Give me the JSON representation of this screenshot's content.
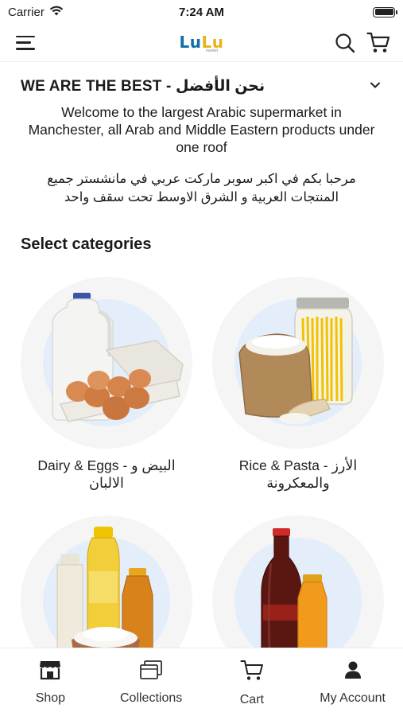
{
  "status_bar": {
    "carrier": "Carrier",
    "time": "7:24 AM"
  },
  "header": {
    "logo_left": "Lu",
    "logo_right": "Lu",
    "logo_sub": "market"
  },
  "welcome": {
    "title": "WE ARE THE BEST - نحن الأفضل",
    "text_en": "Welcome to the largest Arabic supermarket in Manchester, all Arab and Middle Eastern products under one roof",
    "text_ar": "مرحبا بكم في اكبر سوبر ماركت عربي في مانشستر جميع المنتجات العربية و الشرق الاوسط تحت سقف واحد"
  },
  "categories": {
    "title": "Select categories",
    "items": [
      {
        "label": "Dairy & Eggs - البيض و الالبان",
        "icon": "dairy-eggs-image"
      },
      {
        "label": "Rice & Pasta - الأرز والمعكرونة",
        "icon": "rice-pasta-image"
      },
      {
        "label": "",
        "icon": "oils-flour-image"
      },
      {
        "label": "",
        "icon": "drinks-image"
      }
    ]
  },
  "tabbar": {
    "items": [
      {
        "label": "Shop",
        "icon": "shop-icon"
      },
      {
        "label": "Collections",
        "icon": "collections-icon"
      },
      {
        "label": "Cart",
        "icon": "cart-icon"
      },
      {
        "label": "My Account",
        "icon": "account-icon"
      }
    ]
  },
  "colors": {
    "logo_blue": "#0e6ea8",
    "logo_yellow": "#e8b21e",
    "category_bg": "#e3eefa"
  }
}
